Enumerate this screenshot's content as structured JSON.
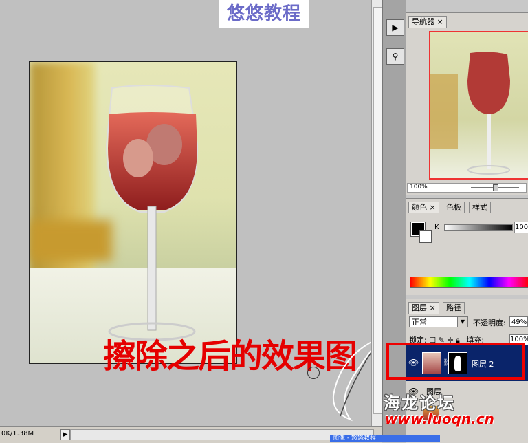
{
  "title_banner": "悠悠教程",
  "caption": "擦除之后的效果图",
  "statusbar": {
    "doc_size": "0K/1.38M",
    "arrow": "▶"
  },
  "dock": {
    "play_icon": "play-icon",
    "tool_icon": "tool-preset-icon"
  },
  "navigator": {
    "tab_label": "导航器",
    "tab_close": "×",
    "zoom": "100%"
  },
  "color_panel": {
    "tabs": [
      "颜色",
      "色板",
      "样式"
    ],
    "tab_close": "×",
    "channel_label": "K",
    "channel_value": "100"
  },
  "layers_panel": {
    "tabs": [
      "图层",
      "路径"
    ],
    "tab_close": "×",
    "blend_mode": "正常",
    "opacity_label": "不透明度:",
    "opacity_value": "49%",
    "lock_label": "锁定:",
    "fill_label": "填充:",
    "fill_value": "100%",
    "layers": [
      {
        "name": "图层 2",
        "selected": true
      },
      {
        "name": "图层",
        "selected": false
      }
    ]
  },
  "watermark": {
    "line1": "海龙论坛",
    "line2": "www.luoqn.cn"
  },
  "taskbar_text": "图像 - 悠悠教程",
  "colors": {
    "highlight": "#0a246a",
    "annotation_red": "#e50000",
    "banner_text": "#6b6bc8"
  }
}
